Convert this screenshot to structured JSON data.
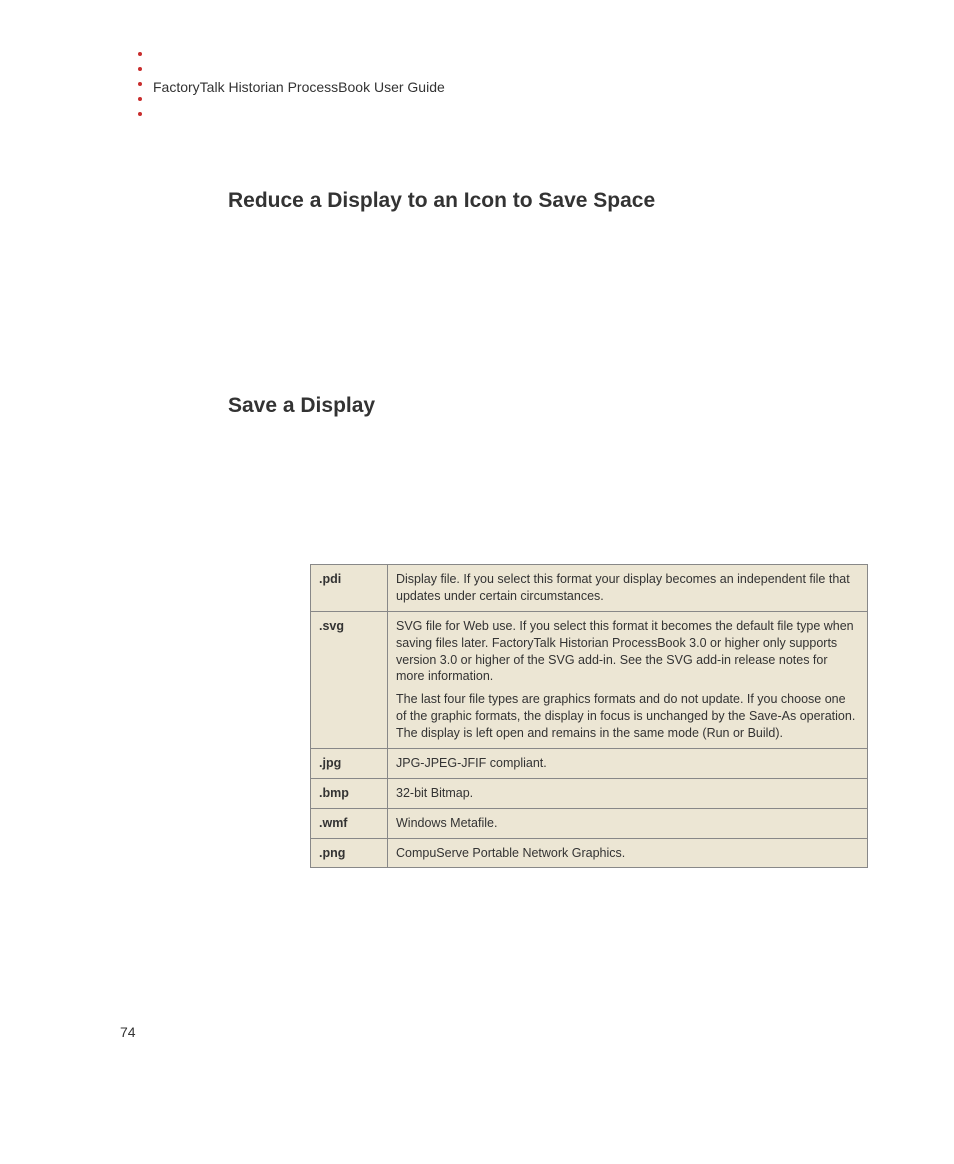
{
  "header": {
    "title": "FactoryTalk Historian ProcessBook User Guide"
  },
  "headings": {
    "h1": "Reduce a Display to an Icon to Save Space",
    "h2": "Save a Display"
  },
  "table": {
    "rows": [
      {
        "ext": ".pdi",
        "desc": "Display file. If you select this format your display becomes an independent file that updates under certain circumstances."
      },
      {
        "ext": ".svg",
        "desc": "SVG file for Web use. If you select this format it becomes the default file type when saving files later. FactoryTalk Historian ProcessBook 3.0 or higher only supports version 3.0 or higher of the SVG add-in. See the SVG add-in release notes for more information.",
        "desc2": "The last four file types are graphics formats and do not update. If you choose one of the graphic formats, the display in focus is unchanged by the Save-As operation. The display is left open and remains in the same mode (Run or Build)."
      },
      {
        "ext": ".jpg",
        "desc": "JPG-JPEG-JFIF compliant."
      },
      {
        "ext": ".bmp",
        "desc": "32-bit Bitmap."
      },
      {
        "ext": ".wmf",
        "desc": "Windows Metafile."
      },
      {
        "ext": ".png",
        "desc": "CompuServe Portable Network Graphics."
      }
    ]
  },
  "pageNumber": "74"
}
